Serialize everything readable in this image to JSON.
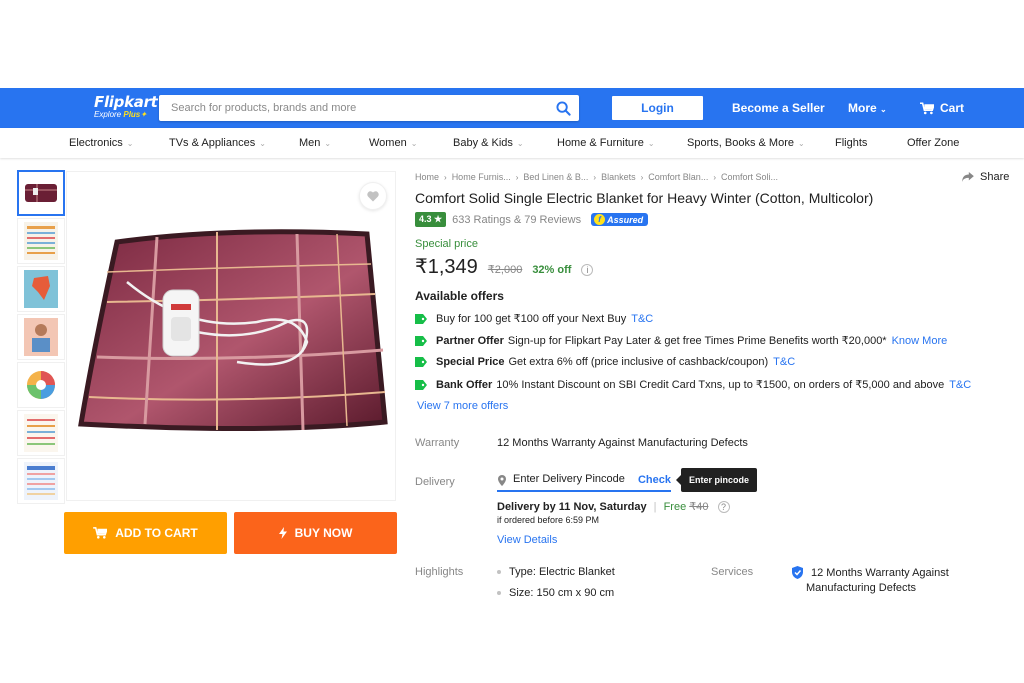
{
  "header": {
    "logo_main": "Flipkart",
    "logo_sub_prefix": "Explore",
    "logo_sub_plus": "Plus",
    "search_placeholder": "Search for products, brands and more",
    "login_label": "Login",
    "seller_label": "Become a Seller",
    "more_label": "More",
    "cart_label": "Cart",
    "brand_color": "#2874f0"
  },
  "categories": [
    "Electronics",
    "TVs & Appliances",
    "Men",
    "Women",
    "Baby & Kids",
    "Home & Furniture",
    "Sports, Books & More",
    "Flights",
    "Offer Zone"
  ],
  "breadcrumb": [
    "Home",
    "Home Furnis...",
    "Bed Linen & B...",
    "Blankets",
    "Comfort Blan...",
    "Comfort Soli..."
  ],
  "share_label": "Share",
  "product": {
    "title": "Comfort Solid Single Electric Blanket for Heavy Winter  (Cotton, Multicolor)",
    "rating": "4.3",
    "rating_star": "★",
    "rating_text": "633 Ratings & 79 Reviews",
    "assured": "Assured",
    "special_price_label": "Special price",
    "price": "₹1,349",
    "mrp": "₹2,000",
    "discount": "32% off"
  },
  "offers": {
    "heading": "Available offers",
    "items": [
      {
        "title": "",
        "text": "Buy for 100 get ₹100 off your Next Buy",
        "link": "T&C"
      },
      {
        "title": "Partner Offer",
        "text": "Sign-up for Flipkart Pay Later & get free Times Prime Benefits worth ₹20,000*",
        "link": "Know More"
      },
      {
        "title": "Special Price",
        "text": "Get extra 6% off (price inclusive of cashback/coupon)",
        "link": "T&C"
      },
      {
        "title": "Bank Offer",
        "text": "10% Instant Discount on SBI Credit Card Txns, up to ₹1500, on orders of ₹5,000 and above",
        "link": "T&C"
      }
    ],
    "view_more": "View 7 more offers"
  },
  "warranty": {
    "label": "Warranty",
    "value": "12 Months Warranty Against Manufacturing Defects"
  },
  "delivery": {
    "label": "Delivery",
    "pincode_placeholder": "Enter Delivery Pincode",
    "check_label": "Check",
    "tooltip": "Enter pincode",
    "by_text": "Delivery by 11 Nov, Saturday",
    "separator": "|",
    "free_label": "Free",
    "free_mrp": "₹40",
    "help": "?",
    "note": "if ordered before 6:59 PM",
    "view_details": "View Details"
  },
  "highlights": {
    "label": "Highlights",
    "items": [
      "Type: Electric Blanket",
      "Size: 150 cm x 90 cm"
    ]
  },
  "services": {
    "label": "Services",
    "items": [
      "12 Months Warranty Against",
      "Manufacturing Defects"
    ]
  },
  "buttons": {
    "add_to_cart": "ADD TO CART",
    "buy_now": "BUY NOW"
  },
  "colors": {
    "add_to_cart": "#ff9f00",
    "buy_now": "#fb641b",
    "rating_green": "#388e3c",
    "link_blue": "#2874f0"
  }
}
